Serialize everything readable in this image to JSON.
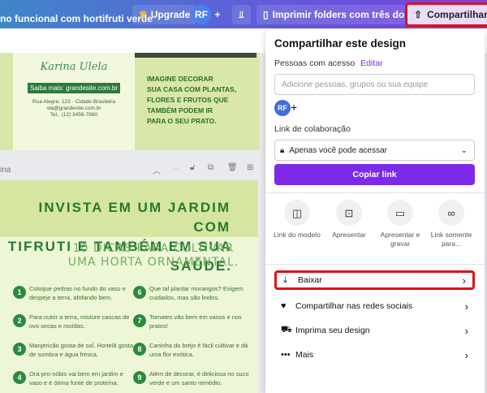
{
  "topbar": {
    "title": "no funcional com hortifruti verde",
    "upgrade": "Upgrade",
    "avatar": "RF",
    "add": "+",
    "print": "Imprimir folders com três dobras",
    "share": "Compartilhar"
  },
  "page1": {
    "signature": "Karina Ulela",
    "saiba": "Saiba mais: grandesite.com.br",
    "addr1": "Rua Alegre, 123 - Cidade Brasileira",
    "addr2": "ola@grandesite.com.br",
    "addr3": "Tel.: (12) 3456-7890",
    "imagine": [
      "IMAGINE DECORAR",
      "SUA CASA COM PLANTAS,",
      "FLORES E FRUTOS QUE",
      "TAMBÉM PODEM IR",
      "PARA O SEU PRATO."
    ]
  },
  "pagebar": {
    "label": "ina"
  },
  "page2": {
    "head1": "INVISTA EM UM JARDIM COM",
    "head2": "TIFRUTI E TAMBÉM EM SUA SAÚDE.",
    "sub1": "10 DICAS PARA CULTIVAR",
    "sub2": "UMA HORTA ORNAMENTAL.",
    "tips": [
      {
        "n": "1",
        "t": "Coloque pedras no fundo do vaso e despeje a terra, afofando bem."
      },
      {
        "n": "2",
        "t": "Para nutrir a terra, misture cascas de ovo secas e moídas."
      },
      {
        "n": "3",
        "t": "Manjericão gosta de sol. Hortelã gosta de sombra e água fresca."
      },
      {
        "n": "4",
        "t": "Ora-pro-nóbis vai bem em jardim e vaso e é ótima fonte de proteína."
      },
      {
        "n": "6",
        "t": "Que tal plantar morangos? Exigem cuidados, mas são lindos."
      },
      {
        "n": "7",
        "t": "Tomates vão bem em vasos e nos pratos!"
      },
      {
        "n": "8",
        "t": "Caninha do brejo é fácil cultivar e dá uma flor exótica."
      },
      {
        "n": "9",
        "t": "Além de decorar, é deliciosa no suco verde e um santo remédio."
      }
    ]
  },
  "panel": {
    "title": "Compartilhar este design",
    "people": "Pessoas com acesso",
    "edit": "Editar",
    "placeholder": "Adicione pessoas, grupos ou sua equipe",
    "avatar": "RF",
    "collab": "Link de colaboração",
    "access": "Apenas você pode acessar",
    "copy": "Copiar link",
    "options": [
      "Link do modelo",
      "Apresentar",
      "Apresentar e gravar",
      "Link somente para..."
    ],
    "rows": [
      "Baixar",
      "Compartilhar nas redes sociais",
      "Imprima seu design",
      "Mais"
    ]
  },
  "colors": {
    "accent": "#7d2ae8",
    "highlight": "#e0101a"
  }
}
